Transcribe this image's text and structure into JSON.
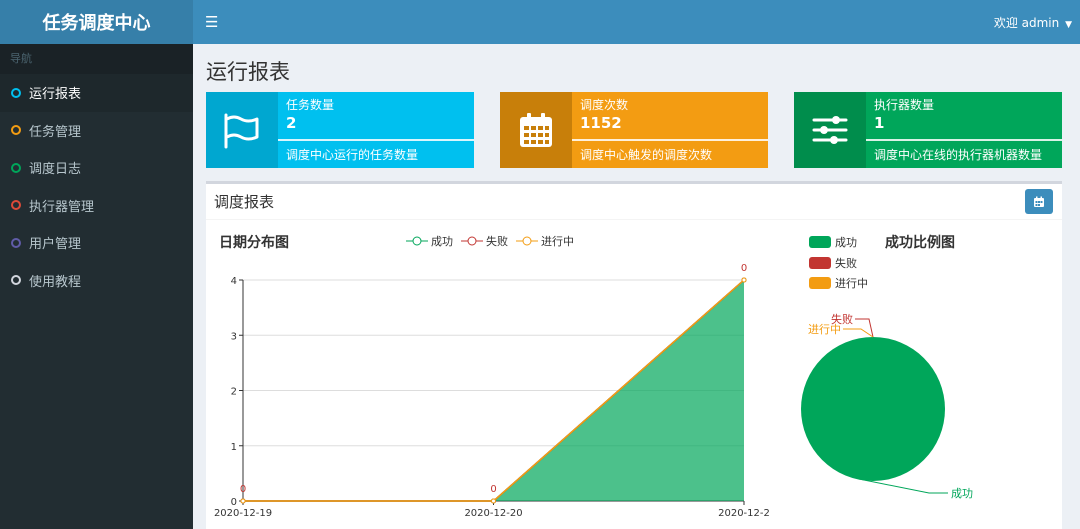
{
  "app": {
    "title": "任务调度中心"
  },
  "header": {
    "user_label": "欢迎 admin"
  },
  "sidebar": {
    "header": "导航",
    "items": [
      {
        "label": "运行报表",
        "color": "#00c0ef",
        "active": true
      },
      {
        "label": "任务管理",
        "color": "#f39c12",
        "active": false
      },
      {
        "label": "调度日志",
        "color": "#00a65a",
        "active": false
      },
      {
        "label": "执行器管理",
        "color": "#dd4b39",
        "active": false
      },
      {
        "label": "用户管理",
        "color": "#605ca8",
        "active": false
      },
      {
        "label": "使用教程",
        "color": "#d2d6de",
        "active": false
      }
    ]
  },
  "page": {
    "title": "运行报表"
  },
  "stats": [
    {
      "label": "任务数量",
      "value": "2",
      "desc": "调度中心运行的任务数量",
      "icon": "flag-icon",
      "color": "#00c0ef",
      "icon_bg": "#00a7d0"
    },
    {
      "label": "调度次数",
      "value": "1152",
      "desc": "调度中心触发的调度次数",
      "icon": "calendar-icon",
      "color": "#f39c12",
      "icon_bg": "#c87f0a"
    },
    {
      "label": "执行器数量",
      "value": "1",
      "desc": "调度中心在线的执行器机器数量",
      "icon": "sliders-icon",
      "color": "#00a65a",
      "icon_bg": "#008d4c"
    }
  ],
  "report": {
    "title": "调度报表"
  },
  "line_chart_title": "日期分布图",
  "pie_chart_title": "成功比例图",
  "chart_data": [
    {
      "type": "area",
      "title": "日期分布图",
      "categories": [
        "2020-12-19",
        "2020-12-20",
        "2020-12-2"
      ],
      "ylim": [
        0,
        4
      ],
      "yticks": [
        0,
        1,
        2,
        3,
        4
      ],
      "series": [
        {
          "name": "成功",
          "values": [
            0,
            0,
            4
          ],
          "color": "#00a65a"
        },
        {
          "name": "失败",
          "values": [
            0,
            0,
            0
          ],
          "color": "#c23531"
        },
        {
          "name": "进行中",
          "values": [
            0,
            0,
            0
          ],
          "color": "#f39c12"
        }
      ],
      "point_labels": [
        "0",
        "0",
        "0"
      ],
      "legend": "top"
    },
    {
      "type": "pie",
      "title": "成功比例图",
      "slices": [
        {
          "name": "成功",
          "value": 100,
          "color": "#00a65a"
        },
        {
          "name": "失败",
          "value": 0,
          "color": "#c23531"
        },
        {
          "name": "进行中",
          "value": 0,
          "color": "#f39c12"
        }
      ],
      "legend": "left"
    }
  ]
}
